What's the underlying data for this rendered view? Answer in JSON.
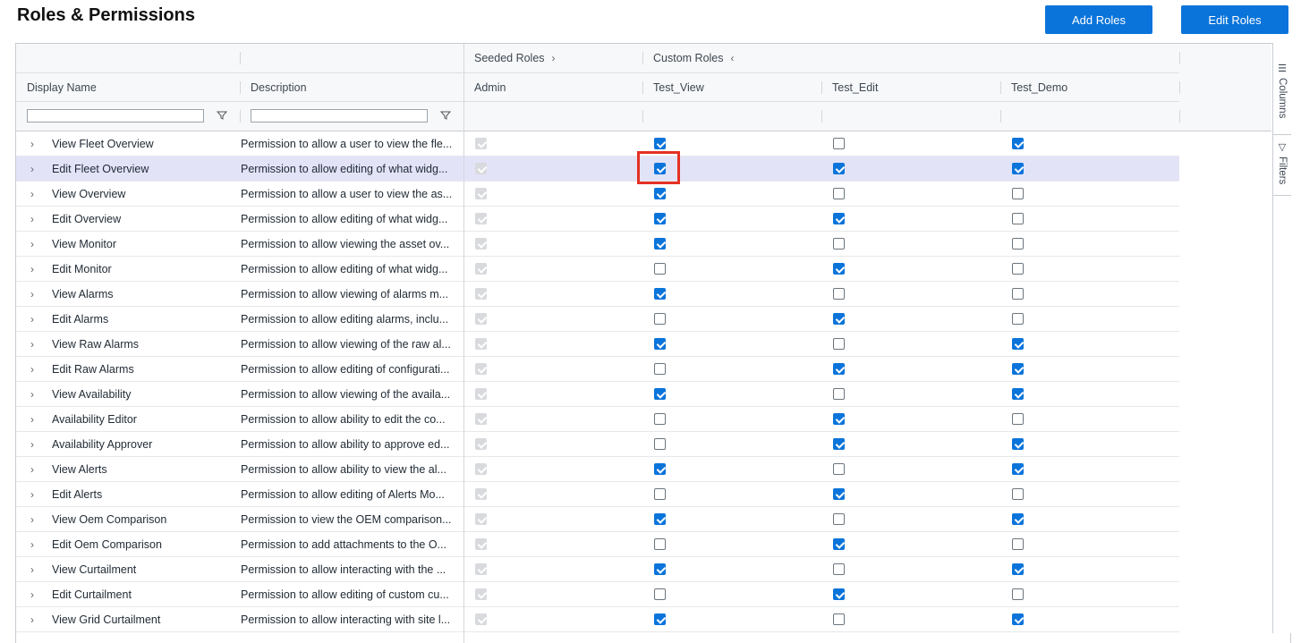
{
  "page": {
    "title": "Roles & Permissions",
    "add_roles_label": "Add Roles",
    "edit_roles_label": "Edit Roles"
  },
  "header": {
    "group_seeded": "Seeded Roles",
    "group_custom": "Custom Roles",
    "col_display_name": "Display Name",
    "col_description": "Description",
    "col_admin": "Admin",
    "col_test_view": "Test_View",
    "col_test_edit": "Test_Edit",
    "col_test_demo": "Test_Demo"
  },
  "sidebar": {
    "columns_label": "Columns",
    "filters_label": "Filters"
  },
  "colors": {
    "accent": "#0a74da",
    "selected_row": "#e3e3f8",
    "highlight": "#e53124"
  },
  "rows": [
    {
      "name": "View Fleet Overview",
      "desc": "Permission to allow a user to view the fle...",
      "admin": true,
      "view": true,
      "edit": false,
      "demo": true
    },
    {
      "name": "Edit Fleet Overview",
      "desc": "Permission to allow editing of what widg...",
      "admin": true,
      "view": true,
      "edit": true,
      "demo": true
    },
    {
      "name": "View Overview",
      "desc": "Permission to allow a user to view the as...",
      "admin": true,
      "view": true,
      "edit": false,
      "demo": false
    },
    {
      "name": "Edit Overview",
      "desc": "Permission to allow editing of what widg...",
      "admin": true,
      "view": true,
      "edit": true,
      "demo": false
    },
    {
      "name": "View Monitor",
      "desc": "Permission to allow viewing the asset ov...",
      "admin": true,
      "view": true,
      "edit": false,
      "demo": false
    },
    {
      "name": "Edit Monitor",
      "desc": "Permission to allow editing of what widg...",
      "admin": true,
      "view": false,
      "edit": true,
      "demo": false
    },
    {
      "name": "View Alarms",
      "desc": "Permission to allow viewing of alarms m...",
      "admin": true,
      "view": true,
      "edit": false,
      "demo": false
    },
    {
      "name": "Edit Alarms",
      "desc": "Permission to allow editing alarms, inclu...",
      "admin": true,
      "view": false,
      "edit": true,
      "demo": false
    },
    {
      "name": "View Raw Alarms",
      "desc": "Permission to allow viewing of the raw al...",
      "admin": true,
      "view": true,
      "edit": false,
      "demo": true
    },
    {
      "name": "Edit Raw Alarms",
      "desc": "Permission to allow editing of configurati...",
      "admin": true,
      "view": false,
      "edit": true,
      "demo": true
    },
    {
      "name": "View Availability",
      "desc": "Permission to allow viewing of the availa...",
      "admin": true,
      "view": true,
      "edit": false,
      "demo": true
    },
    {
      "name": "Availability Editor",
      "desc": "Permission to allow ability to edit the co...",
      "admin": true,
      "view": false,
      "edit": true,
      "demo": false
    },
    {
      "name": "Availability Approver",
      "desc": "Permission to allow ability to approve ed...",
      "admin": true,
      "view": false,
      "edit": true,
      "demo": true
    },
    {
      "name": "View Alerts",
      "desc": "Permission to allow ability to view the al...",
      "admin": true,
      "view": true,
      "edit": false,
      "demo": true
    },
    {
      "name": "Edit Alerts",
      "desc": "Permission to allow editing of Alerts Mo...",
      "admin": true,
      "view": false,
      "edit": true,
      "demo": false
    },
    {
      "name": "View Oem Comparison",
      "desc": "Permission to view the OEM comparison...",
      "admin": true,
      "view": true,
      "edit": false,
      "demo": true
    },
    {
      "name": "Edit Oem Comparison",
      "desc": "Permission to add attachments to the O...",
      "admin": true,
      "view": false,
      "edit": true,
      "demo": false
    },
    {
      "name": "View Curtailment",
      "desc": "Permission to allow interacting with the ...",
      "admin": true,
      "view": true,
      "edit": false,
      "demo": true
    },
    {
      "name": "Edit Curtailment",
      "desc": "Permission to allow editing of custom cu...",
      "admin": true,
      "view": false,
      "edit": true,
      "demo": false
    },
    {
      "name": "View Grid Curtailment",
      "desc": "Permission to allow interacting with site l...",
      "admin": true,
      "view": true,
      "edit": false,
      "demo": true
    }
  ]
}
